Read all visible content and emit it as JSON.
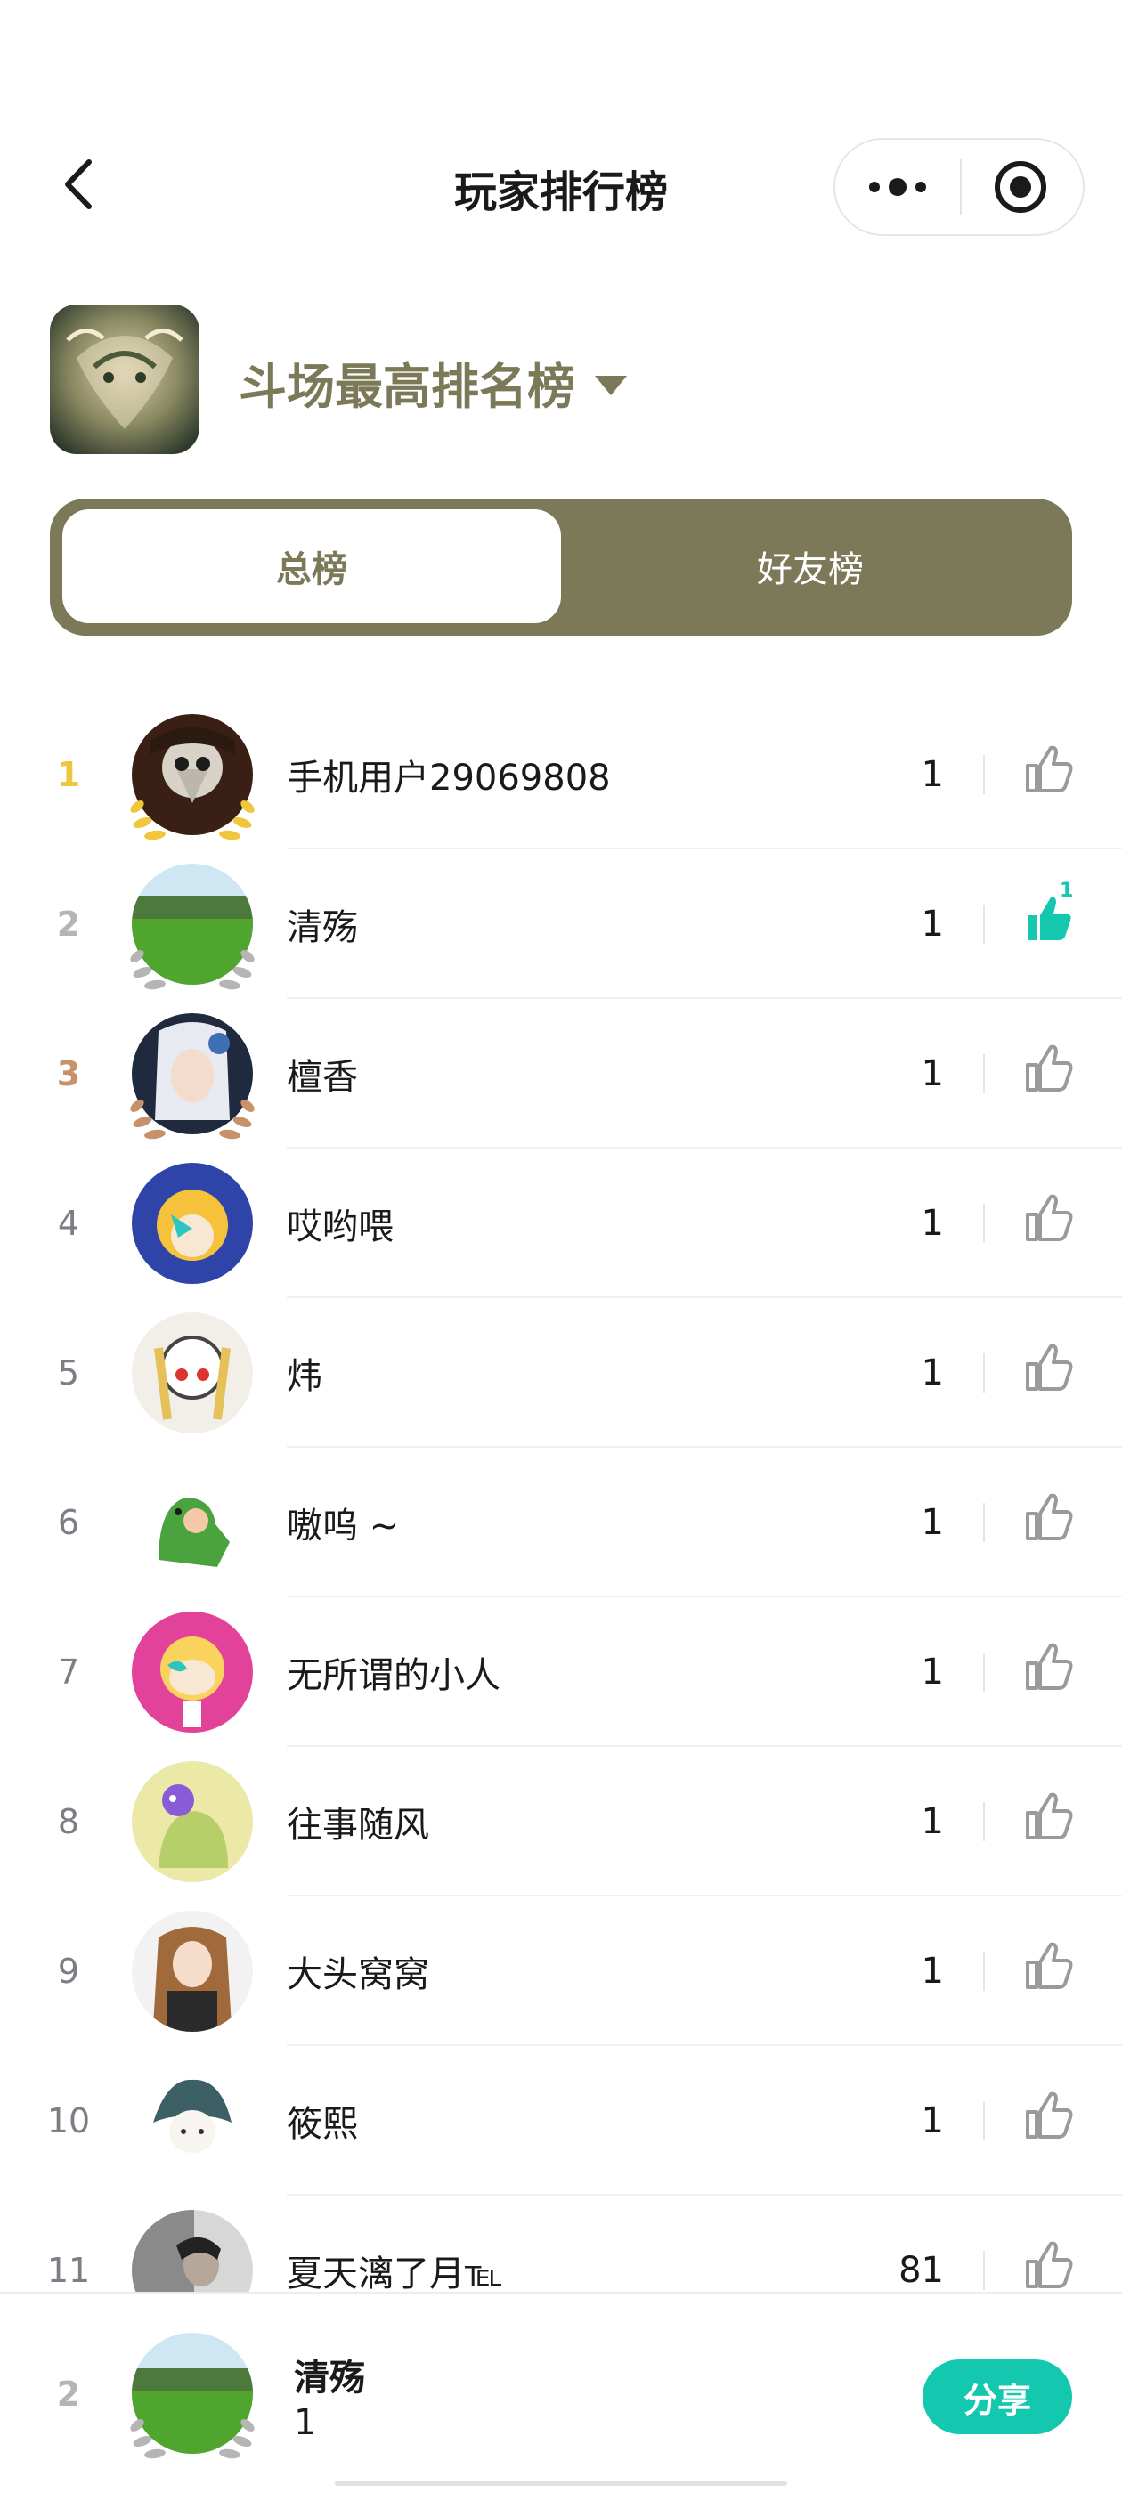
{
  "nav": {
    "title": "玩家排行榜"
  },
  "header": {
    "board_title": "斗场最高排名榜"
  },
  "tabs": [
    {
      "label": "总榜",
      "active": true
    },
    {
      "label": "好友榜",
      "active": false
    }
  ],
  "rows": [
    {
      "rank": "1",
      "name": "手机用户29069808",
      "score": "1",
      "liked": false,
      "like_count": ""
    },
    {
      "rank": "2",
      "name": "清殇",
      "score": "1",
      "liked": true,
      "like_count": "1"
    },
    {
      "rank": "3",
      "name": "檀香",
      "score": "1",
      "liked": false,
      "like_count": ""
    },
    {
      "rank": "4",
      "name": "哎哟喂",
      "score": "1",
      "liked": false,
      "like_count": ""
    },
    {
      "rank": "5",
      "name": "炜",
      "score": "1",
      "liked": false,
      "like_count": ""
    },
    {
      "rank": "6",
      "name": "嗷呜 ~",
      "score": "1",
      "liked": false,
      "like_count": ""
    },
    {
      "rank": "7",
      "name": "无所谓的小人",
      "score": "1",
      "liked": false,
      "like_count": ""
    },
    {
      "rank": "8",
      "name": "往事随风",
      "score": "1",
      "liked": false,
      "like_count": ""
    },
    {
      "rank": "9",
      "name": "大头窝窝",
      "score": "1",
      "liked": false,
      "like_count": ""
    },
    {
      "rank": "10",
      "name": "筱熙",
      "score": "1",
      "liked": false,
      "like_count": ""
    },
    {
      "rank": "11",
      "name": "夏天漓了月℡",
      "score": "81",
      "liked": false,
      "like_count": ""
    }
  ],
  "me": {
    "rank": "2",
    "name": "清殇",
    "score": "1",
    "share_label": "分享"
  },
  "colors": {
    "accent": "#7b7958",
    "like_active": "#14c8b0",
    "gold": "#f0c63a",
    "silver": "#b5b5b5",
    "bronze": "#c7926a"
  },
  "icons": {
    "back": "chevron-left-icon",
    "more": "more-dots-icon",
    "close": "target-circle-icon",
    "like": "thumbs-up-icon",
    "dropdown": "caret-down-icon"
  }
}
